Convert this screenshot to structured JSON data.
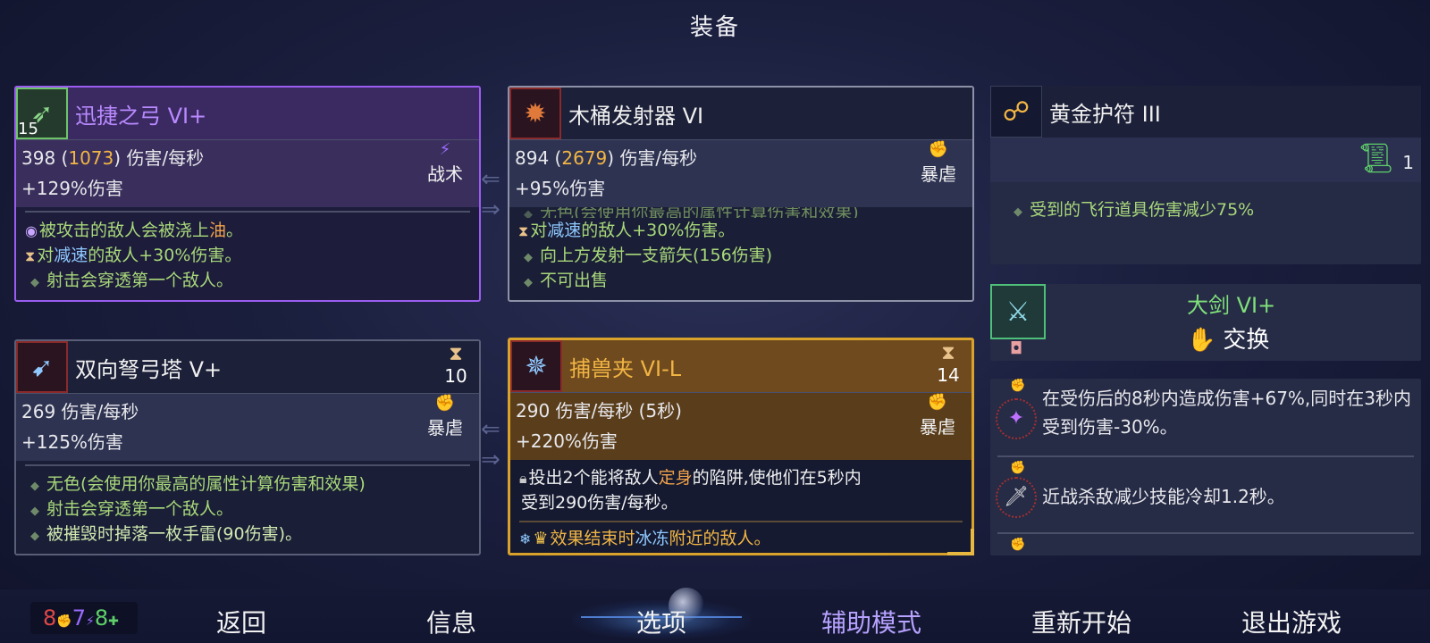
{
  "title": "装备",
  "cards": {
    "bow": {
      "name": "迅捷之弓 VI+",
      "level": "15",
      "dps": "398",
      "dps_alt": "1073",
      "dps_suffix": "伤害/每秒",
      "damage": "+129%伤害",
      "tag": "战术",
      "effects": {
        "e1_a": "被攻击的敌人会被浇上",
        "e1_b": "油",
        "e1_c": "。",
        "e2_a": "对",
        "e2_b": "减速",
        "e2_c": "的敌人+30%伤害。",
        "e3": "射击会穿透第一个敌人。"
      }
    },
    "barrel": {
      "name": "木桶发射器 VI",
      "dps": "894",
      "dps_alt": "2679",
      "dps_suffix": "伤害/每秒",
      "damage": "+95%伤害",
      "tag": "暴虐",
      "effects": {
        "e0": "无色(会使用你最高的属性计算伤害和效果)",
        "e1_a": "对",
        "e1_b": "减速",
        "e1_c": "的敌人+30%伤害。",
        "e2": "向上方发射一支箭矢(156伤害)",
        "e3": "不可出售"
      }
    },
    "turret": {
      "name": "双向弩弓塔 V+",
      "count": "10",
      "dps": "269 伤害/每秒",
      "damage": "+125%伤害",
      "tag": "暴虐",
      "effects": {
        "e1": "无色(会使用你最高的属性计算伤害和效果)",
        "e2": "射击会穿透第一个敌人。",
        "e3": "被摧毁时掉落一枚手雷(90伤害)。"
      }
    },
    "trap": {
      "name": "捕兽夹 VI-L",
      "count": "14",
      "dps": "290 伤害/每秒 (5秒)",
      "damage": "+220%伤害",
      "tag": "暴虐",
      "effects": {
        "e1_a": "投出2个能将敌人",
        "e1_b": "定身",
        "e1_c": "的陷阱,使他们在5秒内",
        "e1_d": "受到290伤害/每秒。",
        "e2_a": "效果结束时",
        "e2_b": "冰冻",
        "e2_c": "附近的敌人。"
      }
    }
  },
  "amulet": {
    "name": "黄金护符 III",
    "scroll_count": "1",
    "effect": "受到的飞行道具伤害减少75%"
  },
  "swap": {
    "name": "大剑 VI+",
    "action": "交换"
  },
  "mutations": {
    "m1": "在受伤后的8秒内造成伤害+67%,同时在3秒内受到伤害-30%。",
    "m2": "近战杀敌减少技能冷却1.2秒。"
  },
  "scrolls": {
    "brutality": "8",
    "tactics": "7",
    "survival": "8"
  },
  "nav": {
    "back": "返回",
    "info": "信息",
    "options": "选项",
    "assist": "辅助模式",
    "restart": "重新开始",
    "quit": "退出游戏"
  },
  "colors": {
    "brutality": "#e04848",
    "tactics": "#9a6bff",
    "survival": "#5fd06a",
    "gold_text": "#f2b544",
    "legendary_border": "#d9a22a",
    "assist_text": "#b7a2ff"
  }
}
